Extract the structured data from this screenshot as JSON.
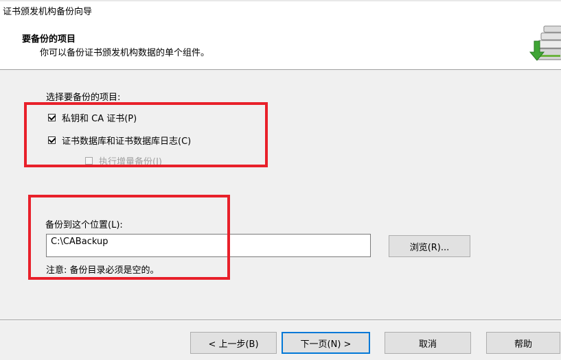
{
  "window": {
    "title": "证书颁发机构备份向导"
  },
  "header": {
    "heading": "要备份的项目",
    "subheading": "你可以备份证书颁发机构数据的单个组件。",
    "icon": "backup-wizard-icon"
  },
  "items": {
    "label": "选择要备份的项目:",
    "private_key": {
      "label": "私钥和 CA 证书(P)",
      "checked": true
    },
    "database": {
      "label": "证书数据库和证书数据库日志(C)",
      "checked": true
    },
    "incremental": {
      "label": "执行增量备份(I)",
      "checked": false,
      "enabled": false
    }
  },
  "location": {
    "label": "备份到这个位置(L):",
    "value": "C:\\CABackup",
    "browse_label": "浏览(R)...",
    "note": "注意: 备份目录必须是空的。"
  },
  "footer": {
    "back_label": "< 上一步(B)",
    "next_label": "下一页(N) >",
    "cancel_label": "取消",
    "help_label": "帮助"
  },
  "colors": {
    "highlight": "#e8202a",
    "focus": "#0078d7"
  }
}
